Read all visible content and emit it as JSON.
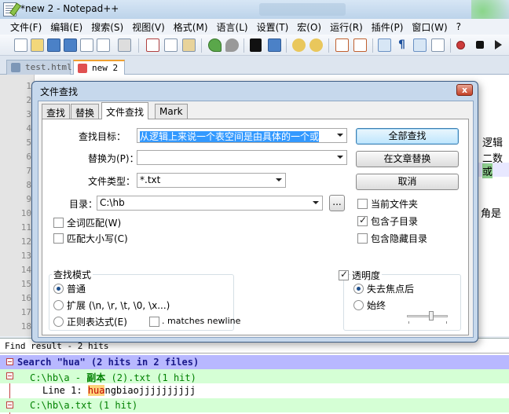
{
  "window": {
    "title": "*new  2 - Notepad++"
  },
  "menu": [
    "文件(F)",
    "编辑(E)",
    "搜索(S)",
    "视图(V)",
    "格式(M)",
    "语言(L)",
    "设置(T)",
    "宏(O)",
    "运行(R)",
    "插件(P)",
    "窗口(W)",
    "?"
  ],
  "toolbar": [
    "new-file-icon",
    "open-file-icon",
    "save-icon",
    "save-all-icon",
    "close-icon",
    "close-all-icon",
    "print-icon",
    "cut-icon",
    "copy-icon",
    "paste-icon",
    "undo-icon",
    "redo-icon",
    "find-icon",
    "replace-icon",
    "zoom-in-icon",
    "zoom-out-icon",
    "sync-vertical-icon",
    "sync-horizontal-icon",
    "word-wrap-icon",
    "show-all-chars-icon",
    "indent-guide-icon",
    "udl-icon",
    "record-macro-icon",
    "stop-record-icon",
    "play-macro-icon"
  ],
  "tabs": [
    {
      "label": "test.html"
    },
    {
      "label": "new  2"
    }
  ],
  "editor": {
    "line_numbers": [
      "1",
      "2",
      "3",
      "4",
      "5",
      "6",
      "7",
      "8",
      "9",
      "10",
      "11",
      "12",
      "13",
      "14",
      "15",
      "16",
      "17",
      "18"
    ],
    "visible_right_text": [
      "逻辑",
      "二数",
      "或",
      "角是"
    ]
  },
  "dialog": {
    "title": "文件查找",
    "close": "x",
    "tabs": [
      "查找",
      "替换",
      "文件查找",
      "Mark"
    ],
    "find_what_label": "查找目标：",
    "find_what_value": "从逻辑上来说一个表空间是由具体的一个或",
    "replace_label": "替换为(P)：",
    "replace_value": "",
    "filetype_label": "文件类型：",
    "filetype_value": "*.txt",
    "dir_label": "目录：",
    "dir_value": "C:\\hb",
    "browse": "...",
    "buttons": {
      "find_all": "全部查找",
      "replace_in_files": "在文章替换",
      "cancel": "取消"
    },
    "options": {
      "current_folder": "当前文件夹",
      "subfolders": "包含子目录",
      "hidden": "包含隐藏目录",
      "whole_word": "全词匹配(W)",
      "match_case": "匹配大小写(C)"
    },
    "search_mode": {
      "title": "查找模式",
      "normal": "普通",
      "extended": "扩展 (\\n, \\r, \\t, \\0, \\x...)",
      "regex": "正则表达式(E)",
      "matches_newline": ". matches newline"
    },
    "transparency": {
      "title": "透明度",
      "on_lose_focus": "失去焦点后",
      "always": "始终",
      "level": 0.6
    }
  },
  "find_result": {
    "header": "Find result - 2 hits",
    "search_line": "Search \"hua\" (2 hits in 2 files)",
    "file1_path": "C:\\hb\\a - ",
    "file1_bold": "副本",
    "file1_rest": " (2).txt (1 hit)",
    "line1_prefix": "Line 1: ",
    "line1_match": "hua",
    "line1_rest": "ngbiaojjjjjjjjjj",
    "file2": "C:\\hb\\a.txt (1 hit)"
  },
  "colors": {
    "search_line_bg": "#b8b8ff",
    "file_line_bg": "#d5ffd5",
    "file_text": "#008000",
    "match_highlight": "#ffd27a"
  }
}
